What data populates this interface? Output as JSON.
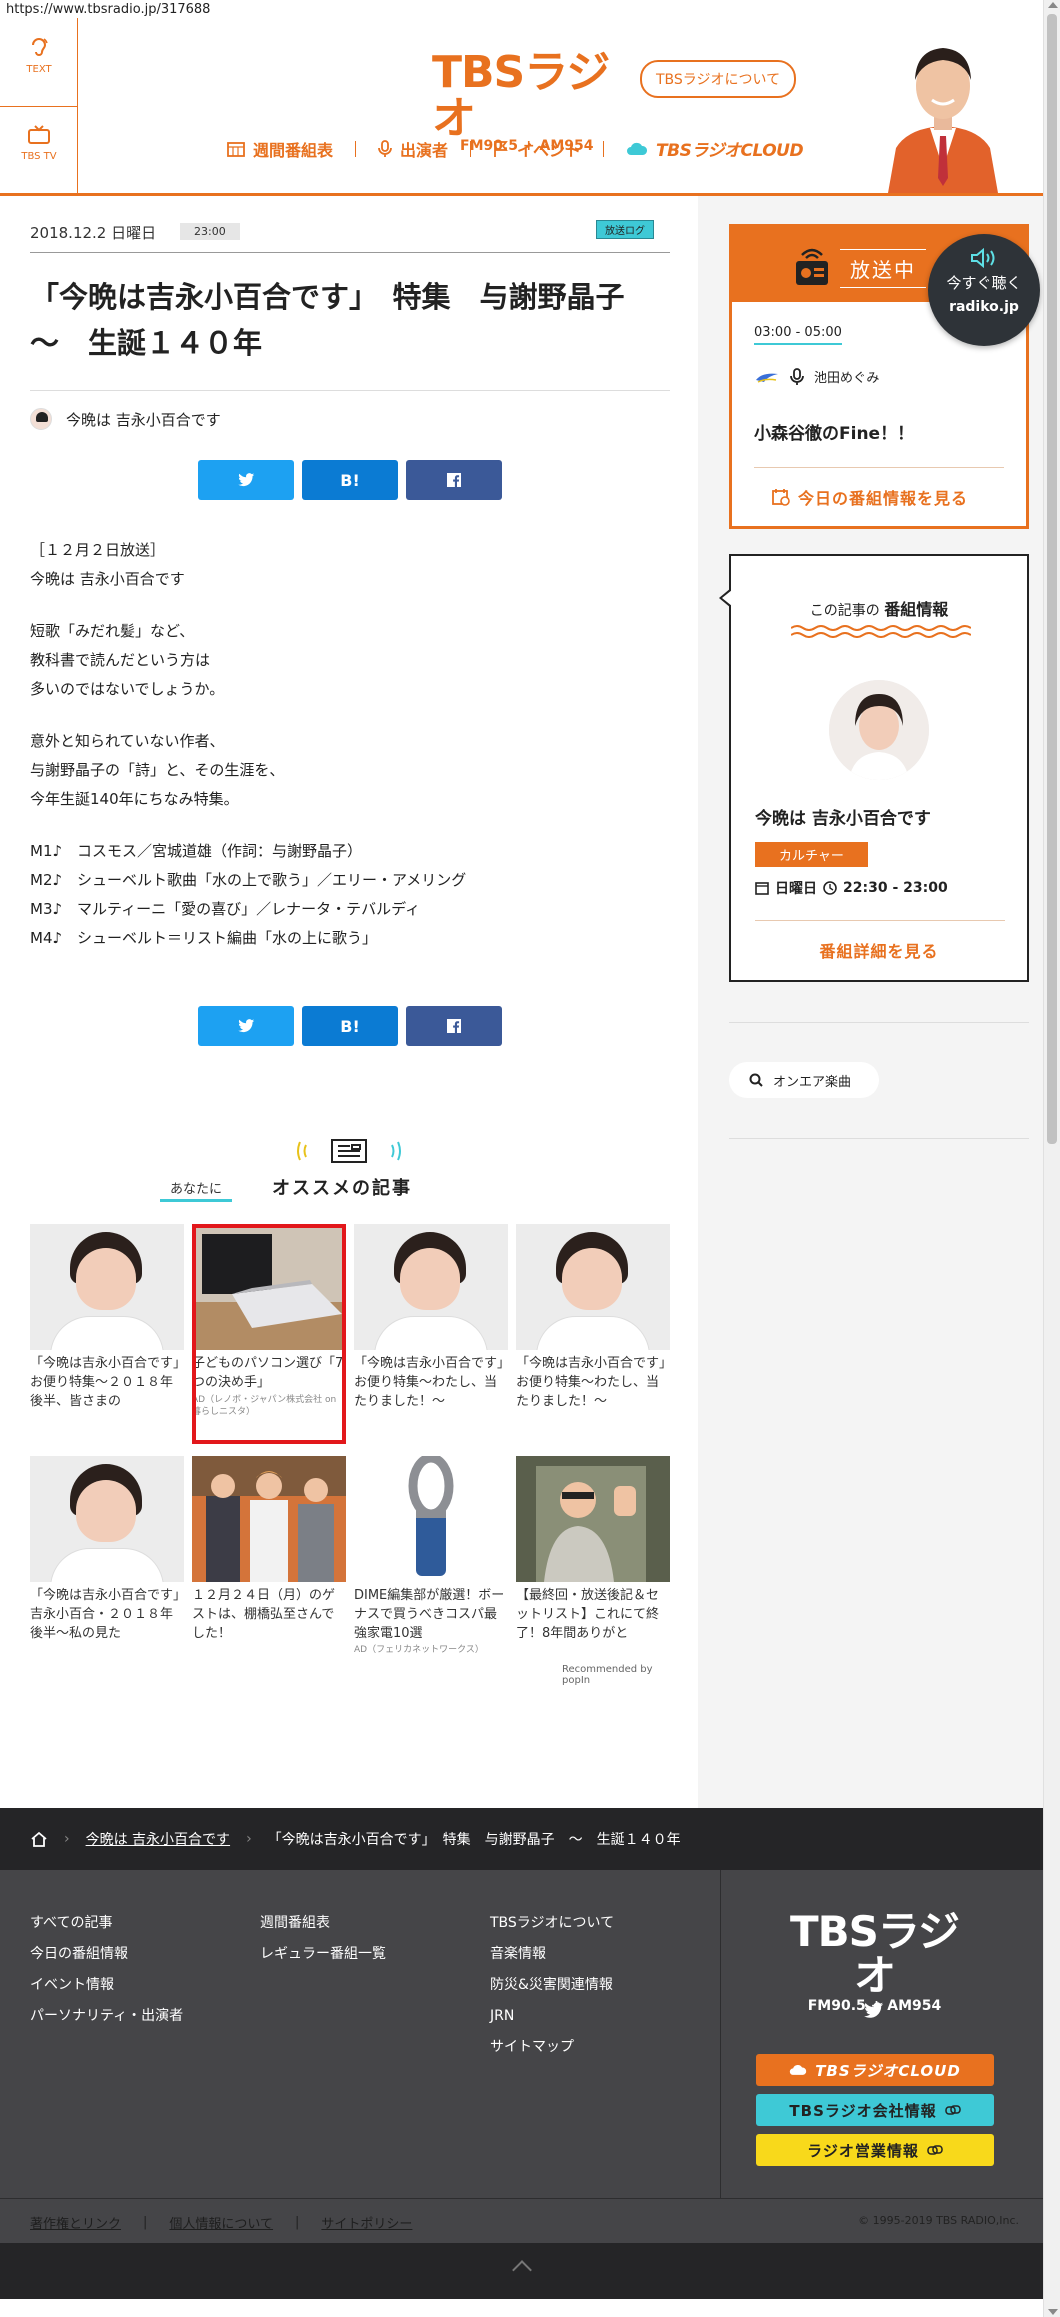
{
  "url": "https://www.tbsradio.jp/317688",
  "header": {
    "left_tabs": [
      {
        "label": "TEXT"
      },
      {
        "label": "TBS TV"
      }
    ],
    "logo": "TBSラジオ",
    "logo_sub": "FM90.5 + AM954",
    "about": "TBSラジオについて",
    "nav": [
      {
        "label": "週間番組表"
      },
      {
        "label": "出演者"
      },
      {
        "label": "イベント"
      },
      {
        "label": "TBSラジオCLOUD"
      }
    ]
  },
  "article": {
    "date": "2018.12.2 日曜日",
    "time": "23:00",
    "tag": "放送ログ",
    "title": "「今晩は吉永小百合です」　特集　与謝野晶子　～　生誕１４０年",
    "program": "今晩は 吉永小百合です",
    "share": {
      "twitter": "",
      "hatena": "B!",
      "facebook": ""
    },
    "body": [
      [
        "［１２月２日放送］",
        "今晩は 吉永小百合です"
      ],
      [
        "短歌「みだれ髪」など、",
        "教科書で読んだという方は",
        "多いのではないでしょうか。"
      ],
      [
        "意外と知られていない作者、",
        "与謝野晶子の「詩」と、その生涯を、",
        "今年生誕140年にちなみ特集。"
      ],
      [
        "M1♪　コスモス／宮城道雄（作詞：与謝野晶子）",
        "M2♪　シューベルト歌曲「水の上で歌う」／エリー・アメリング",
        "M3♪　マルティーニ「愛の喜び」／レナータ・テバルディ",
        "M4♪　シューベルト＝リスト編曲「水の上に歌う」"
      ]
    ]
  },
  "reco": {
    "sub": "あなたに",
    "title": "オススメの記事",
    "cards": [
      {
        "caption": "「今晩は吉永小百合です」お便り特集～２０１８年後半、皆さまの",
        "ad": ""
      },
      {
        "caption": "子どものパソコン選び「7つの決め手」",
        "ad": "AD（レノボ・ジャパン株式会社 on 暮らしニスタ）"
      },
      {
        "caption": "「今晩は吉永小百合です」お便り特集～わたし、当たりました！～",
        "ad": ""
      },
      {
        "caption": "「今晩は吉永小百合です」お便り特集～わたし、当たりました！～",
        "ad": ""
      },
      {
        "caption": "「今晩は吉永小百合です」吉永小百合・２０１８年後半～私の見た",
        "ad": ""
      },
      {
        "caption": "１２月２４日（月）のゲストは、棚橋弘至さんでした！",
        "ad": ""
      },
      {
        "caption": "DIME編集部が厳選！ボーナスで買うべきコスパ最強家電10選",
        "ad": "AD（フェリカネットワークス）"
      },
      {
        "caption": "【最終回・放送後記＆セットリスト】これにて終了！8年間ありがと",
        "ad": ""
      }
    ],
    "powered": "Recommended by popIn"
  },
  "onair": {
    "label": "放送中",
    "time": "03:00 - 05:00",
    "host": "池田めぐみ",
    "program": "小森谷徹のFine！！",
    "link": "今日の番組情報を見る"
  },
  "radiko": {
    "line1": "今すぐ聴く",
    "line2": "radiko.jp"
  },
  "proginfo": {
    "heading_small": "この記事の",
    "heading_bold": "番組情報",
    "name": "今晩は 吉永小百合です",
    "genre": "カルチャー",
    "day": "日曜日",
    "time": "22:30 - 23:00",
    "link": "番組詳細を見る"
  },
  "onair_song": "オンエア楽曲",
  "breadcrumb": {
    "program": "今晩は 吉永小百合です",
    "current": "「今晩は吉永小百合です」　特集　与謝野晶子　～　生誕１４０年"
  },
  "footer": {
    "col1": [
      "すべての記事",
      "今日の番組情報",
      "イベント情報",
      "パーソナリティ・出演者"
    ],
    "col2": [
      "週間番組表",
      "レギュラー番組一覧"
    ],
    "col3": [
      "TBSラジオについて",
      "音楽情報",
      "防災&災害関連情報",
      "JRN",
      "サイトマップ"
    ],
    "logo": "TBSラジオ",
    "logo_sub": "FM90.5 + AM954",
    "buttons": [
      "TBSラジオCLOUD",
      "TBSラジオ会社情報",
      "ラジオ営業情報"
    ],
    "bottom_links": [
      "著作権とリンク",
      "個人情報について",
      "サイトポリシー"
    ],
    "copyright": "© 1995-2019 TBS RADIO,Inc."
  },
  "colors": {
    "accent": "#e8711f",
    "cyan": "#3ec9d6",
    "dark": "#252527",
    "footer": "#454548",
    "yellow": "#f8d91b"
  }
}
